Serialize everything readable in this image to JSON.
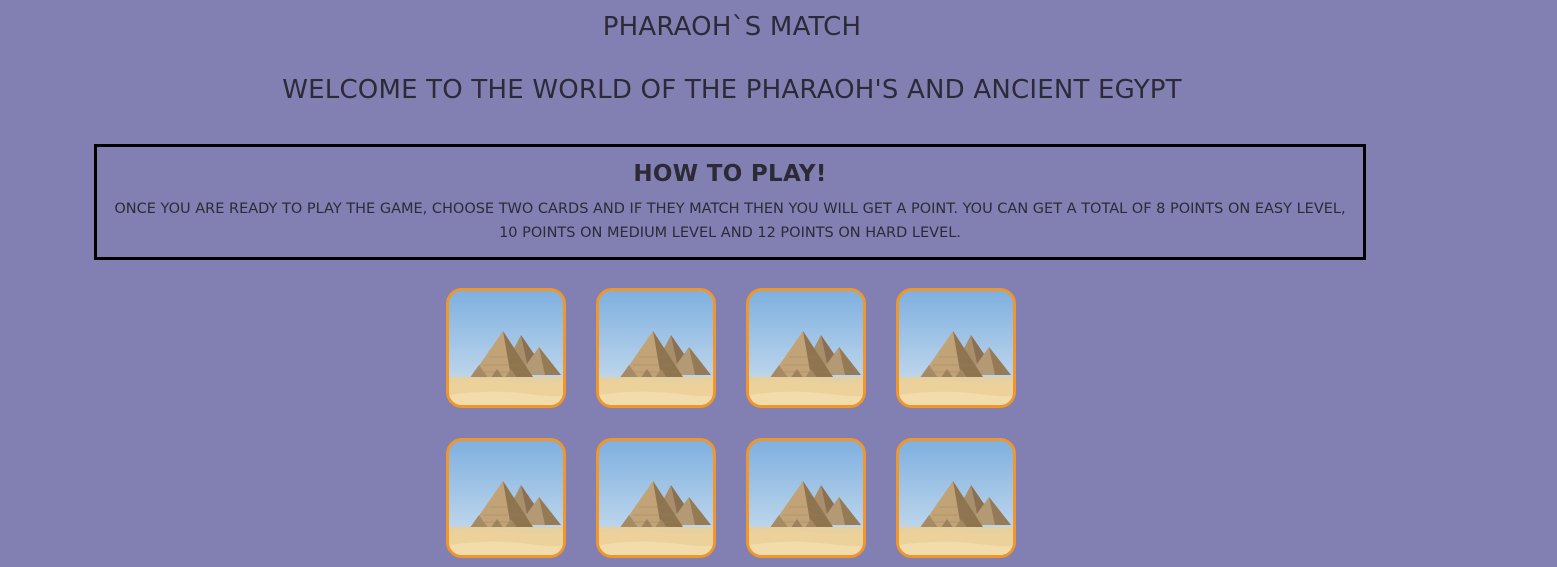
{
  "header": {
    "title": "PHARAOH`S MATCH",
    "welcome": "WELCOME TO THE WORLD OF THE PHARAOH'S AND ANCIENT EGYPT"
  },
  "instructions": {
    "title": "HOW TO PLAY!",
    "text": "ONCE YOU ARE READY TO PLAY THE GAME, CHOOSE TWO CARDS AND IF THEY MATCH THEN YOU WILL GET A POINT. YOU CAN GET A TOTAL OF 8 POINTS ON EASY LEVEL, 10 POINTS ON MEDIUM LEVEL AND 12 POINTS ON HARD LEVEL."
  },
  "board": {
    "card_image": "pyramids-icon",
    "cards": [
      {
        "state": "face-down"
      },
      {
        "state": "face-down"
      },
      {
        "state": "face-down"
      },
      {
        "state": "face-down"
      },
      {
        "state": "face-down"
      },
      {
        "state": "face-down"
      },
      {
        "state": "face-down"
      },
      {
        "state": "face-down"
      }
    ]
  },
  "colors": {
    "background": "#8280b3",
    "card_border": "#f0962a",
    "text": "#2b2a36"
  }
}
